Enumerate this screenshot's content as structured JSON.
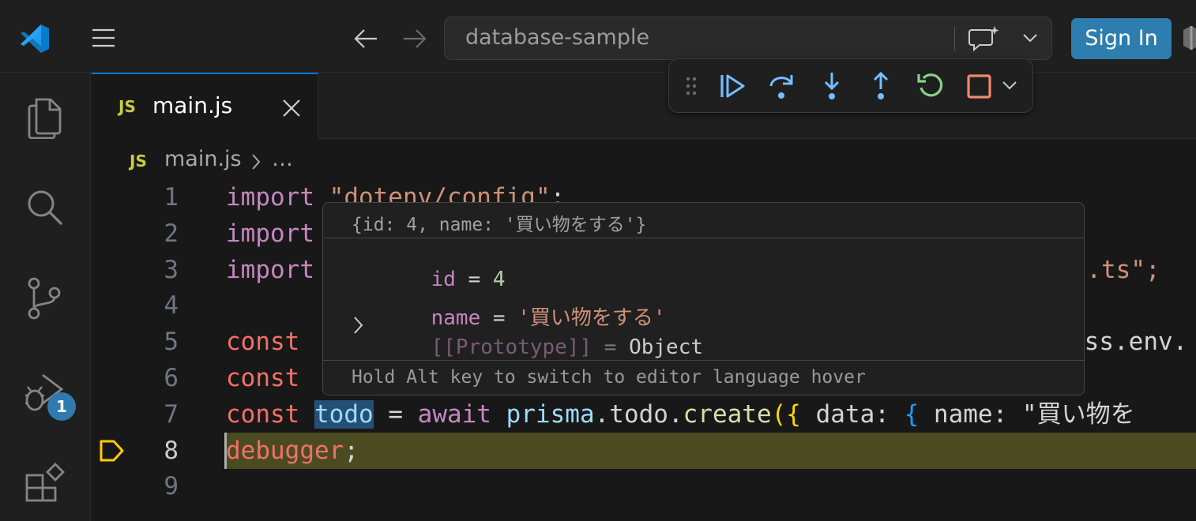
{
  "titlebar": {
    "search_text": "database-sample",
    "sign_in_label": "Sign In"
  },
  "activity": {
    "debug_badge": "1"
  },
  "tab": {
    "icon_label": "JS",
    "filename": "main.js"
  },
  "breadcrumb": {
    "icon_label": "JS",
    "file": "main.js",
    "separator": ">",
    "rest": "…"
  },
  "code": {
    "line_numbers": [
      "1",
      "2",
      "3",
      "4",
      "5",
      "6",
      "7",
      "8",
      "9"
    ],
    "l1": {
      "kw": "import",
      "str": "\"dotenv/config\"",
      "end": ";"
    },
    "l2": {
      "kw": "import"
    },
    "l3": {
      "kw": "import",
      "tail": "nt.ts\";"
    },
    "l5": {
      "kw": "const",
      "tail": "ess.env."
    },
    "l6": {
      "kw": "const"
    },
    "l7": {
      "kw": "const",
      "var": "todo",
      "eq": " = ",
      "await": "await",
      "obj": "prisma",
      "dot1": ".todo.",
      "fn": "create",
      "open": "({",
      "data": " data: ",
      "brace": "{",
      "name": " name: ",
      "str": "\"買い物を"
    },
    "l8": {
      "kw": "debugger",
      "end": ";"
    }
  },
  "hover": {
    "header": "{id: 4, name: '買い物をする'}",
    "id_key": "id",
    "id_eq": " = ",
    "id_val": "4",
    "name_key": "name",
    "name_eq": " = ",
    "name_val": "'買い物をする'",
    "proto_key": "[[Prototype]]",
    "proto_eq": " = ",
    "proto_val": "Object",
    "footer": "Hold Alt key to switch to editor language hover"
  }
}
